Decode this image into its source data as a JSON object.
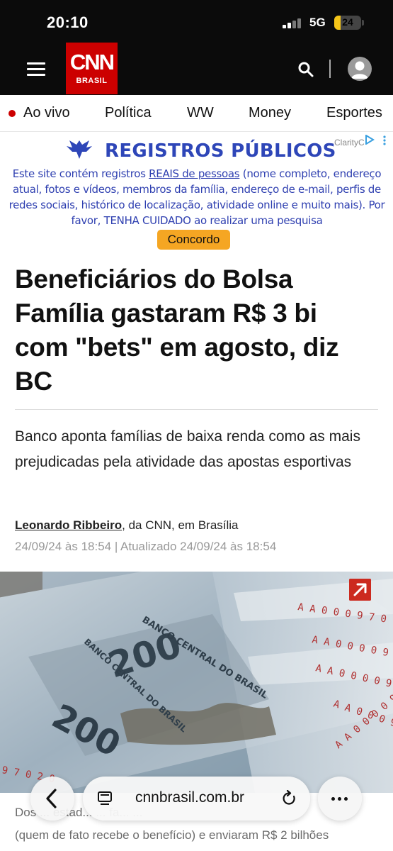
{
  "status_bar": {
    "time": "20:10",
    "network": "5G",
    "battery": "24",
    "battery_level": 0.24,
    "battery_color": "#f5c518"
  },
  "header": {
    "logo_primary": "CNN",
    "logo_secondary": "BRASIL",
    "menu_icon": "hamburger-menu-icon",
    "search_icon": "search-icon",
    "account_icon": "user-avatar-icon",
    "brand_color": "#cc0000"
  },
  "nav": {
    "items": [
      {
        "label": "Ao vivo",
        "live": true
      },
      {
        "label": "Política"
      },
      {
        "label": "WW"
      },
      {
        "label": "Money"
      },
      {
        "label": "Esportes"
      }
    ]
  },
  "ad": {
    "title": "REGISTROS PÚBLICOS",
    "sponsor": "ClarityC",
    "text_before": "Este site contém registros ",
    "text_link": "REAIS de pessoas",
    "text_after": " (nome completo, endereço atual, fotos e vídeos, membros da família, endereço de e-mail, perfis de redes sociais, histórico de localização, atividade online e muito mais). Por favor, TENHA CUIDADO ao realizar uma pesquisa",
    "button_label": "Concordo",
    "accent_color": "#2e46b8",
    "button_color": "#f5a623"
  },
  "article": {
    "headline": "Beneficiários do Bolsa Família gastaram R$ 3 bi com \"bets\" em agosto, diz BC",
    "subheadline": "Banco aponta famílias de baixa renda como as mais prejudicadas pela atividade das apostas esportivas",
    "author": "Leonardo Ribbeiro",
    "author_suffix": ", da CNN, em Brasília",
    "dates": "24/09/24 às 18:54 | Atualizado 24/09/24 às 18:54",
    "image_text_1": "BANCO CENTRAL DO BRASIL",
    "image_text_2": "200",
    "caption_line_1": "Dos ... estad... ... fa... ...",
    "caption_line_2": "(quem de fato recebe o benefício) e enviaram R$ 2 bilhões"
  },
  "browser": {
    "url": "cnnbrasil.com.br",
    "back_icon": "chevron-left-icon",
    "reader_icon": "reader-mode-icon",
    "reload_icon": "reload-icon",
    "more_icon": "more-dots-icon"
  }
}
